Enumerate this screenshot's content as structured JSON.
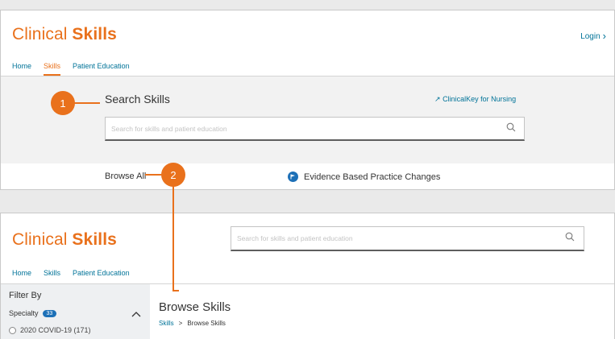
{
  "app": {
    "logo_part1": "Clinical",
    "logo_part2": " Skills"
  },
  "top": {
    "nav": [
      "Home",
      "Skills",
      "Patient Education"
    ],
    "active_nav": "Skills",
    "login_label": "Login",
    "hero_title": "Search Skills",
    "clinicalkey_link": "ClinicalKey for Nursing",
    "search_placeholder": "Search for skills and patient education",
    "browse_all": "Browse All",
    "ebp_label": "Evidence Based Practice Changes"
  },
  "bottom": {
    "nav": [
      "Home",
      "Skills",
      "Patient Education"
    ],
    "search_placeholder": "Search for skills and patient education",
    "filter_title": "Filter By",
    "specialty_label": "Specialty",
    "specialty_count": "33",
    "filter_option": "2020 COVID-19 (171)",
    "page_title": "Browse Skills",
    "breadcrumb_link": "Skills",
    "breadcrumb_sep": ">",
    "breadcrumb_current": "Browse Skills"
  },
  "callouts": [
    "1",
    "2"
  ],
  "icons": [
    "search-icon",
    "external-link-icon",
    "chevron-right-icon",
    "flag-icon",
    "chevron-up-icon",
    "radio-icon"
  ],
  "colors": {
    "brand": "#e9711c",
    "link": "#007398",
    "badge": "#1d70b7",
    "hero_bg": "#f2f2f2"
  }
}
